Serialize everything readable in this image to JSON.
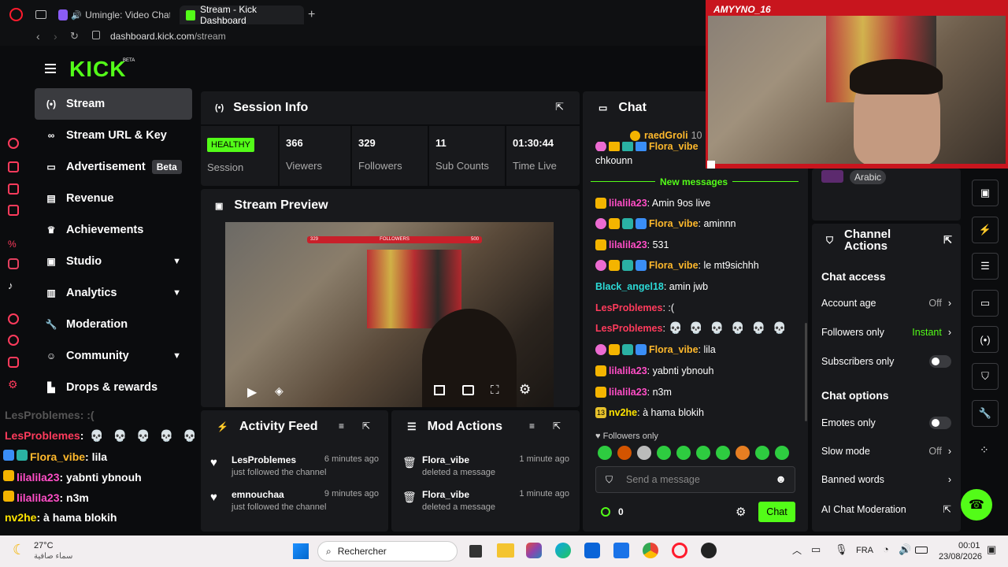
{
  "browser": {
    "tabs": [
      {
        "label": "Umingle: Video Chat w"
      },
      {
        "label": "Stream - Kick Dashboard"
      }
    ],
    "url_host": "dashboard.kick.com",
    "url_path": "/stream"
  },
  "brand": {
    "logo": "KICK",
    "beta": "BETA"
  },
  "sidebar": {
    "items": [
      {
        "label": "Stream",
        "icon": "stream-icon"
      },
      {
        "label": "Stream URL & Key",
        "icon": "link-icon"
      },
      {
        "label": "Advertisement",
        "icon": "ad-icon",
        "badge": "Beta"
      },
      {
        "label": "Revenue",
        "icon": "revenue-icon"
      },
      {
        "label": "Achievements",
        "icon": "trophy-icon"
      },
      {
        "label": "Studio",
        "icon": "studio-icon"
      },
      {
        "label": "Analytics",
        "icon": "analytics-icon"
      },
      {
        "label": "Moderation",
        "icon": "wrench-icon"
      },
      {
        "label": "Community",
        "icon": "community-icon"
      },
      {
        "label": "Drops & rewards",
        "icon": "drops-icon"
      }
    ]
  },
  "session": {
    "title": "Session Info",
    "status": "HEALTHY",
    "status_label": "Session",
    "stats": [
      {
        "value": "366",
        "label": "Viewers"
      },
      {
        "value": "329",
        "label": "Followers"
      },
      {
        "value": "11",
        "label": "Sub Counts"
      },
      {
        "value": "01:30:44",
        "label": "Time Live"
      }
    ]
  },
  "preview": {
    "title": "Stream Preview",
    "overlay_label": "FOLLOWERS",
    "overlay_left": "329",
    "overlay_right": "500"
  },
  "activity": {
    "title": "Activity Feed",
    "items": [
      {
        "user": "LesProblemes",
        "time": "6 minutes ago",
        "action": "just followed the channel"
      },
      {
        "user": "emnouchaa",
        "time": "9 minutes ago",
        "action": "just followed the channel"
      }
    ]
  },
  "mod": {
    "title": "Mod Actions",
    "items": [
      {
        "user": "Flora_vibe",
        "time": "1 minute ago",
        "action": "deleted a message"
      },
      {
        "user": "Flora_vibe",
        "time": "1 minute ago",
        "action": "deleted a message"
      }
    ]
  },
  "chat": {
    "title": "Chat",
    "pinned_user": "raedGroli",
    "pinned_count": "10",
    "partial_user": "Flora_vibe",
    "partial_text": "chkounn",
    "new_messages": "New messages",
    "messages": [
      {
        "user": "lilalila23",
        "text": ": Amin 9os live"
      },
      {
        "user": "Flora_vibe",
        "text": ": aminnn"
      },
      {
        "user": "lilalila23",
        "text": ": 531"
      },
      {
        "user": "Flora_vibe",
        "text": ": le mt9sichhh"
      },
      {
        "user": "Black_angel18",
        "text": ": amin jwb"
      },
      {
        "user": "LesProblemes",
        "text": ": :("
      },
      {
        "user": "LesProblemes",
        "text": ": "
      },
      {
        "user": "Flora_vibe",
        "text": ": lila"
      },
      {
        "user": "lilalila23",
        "text": ": yabnti ybnouh"
      },
      {
        "user": "lilalila23",
        "text": ": n3m"
      },
      {
        "user": "nv2he",
        "text": ": à hama blokih"
      }
    ],
    "sub_badge": "13",
    "followers_only": "Followers only",
    "placeholder": "Send a message",
    "count": "0",
    "send": "Chat"
  },
  "webcam": {
    "name": "AMYYNO_16"
  },
  "language": {
    "label": "Arabic"
  },
  "channel_actions": {
    "title": "Channel Actions",
    "access_title": "Chat access",
    "rows": [
      {
        "label": "Account age",
        "value": "Off"
      },
      {
        "label": "Followers only",
        "value": "Instant"
      },
      {
        "label": "Subscribers only"
      }
    ],
    "options_title": "Chat options",
    "options": [
      {
        "label": "Emotes only"
      },
      {
        "label": "Slow mode",
        "value": "Off"
      },
      {
        "label": "Banned words"
      },
      {
        "label": "AI Chat Moderation"
      }
    ]
  },
  "overlay_chat": [
    {
      "user": "LesProblemes",
      "text": ": :("
    },
    {
      "user": "LesProblemes",
      "text": ":"
    },
    {
      "user": "Flora_vibe",
      "text": ": lila"
    },
    {
      "user": "lilalila23",
      "text": ": yabnti ybnouh"
    },
    {
      "user": "lilalila23",
      "text": ": n3m"
    },
    {
      "user": "nv2he",
      "text": ": à hama blokih"
    }
  ],
  "taskbar": {
    "temp": "27°C",
    "weather": "سماء صافية",
    "search": "Rechercher",
    "lang": "FRA",
    "time": "00:01",
    "date": "23/08/2026"
  },
  "colors": {
    "accent": "#53fc18",
    "panel": "#18191c"
  }
}
